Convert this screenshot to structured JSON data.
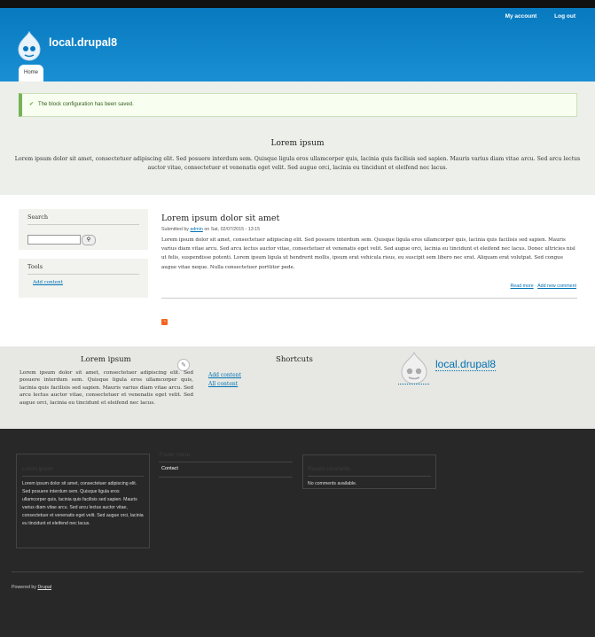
{
  "header": {
    "secondary_menu": [
      "My account",
      "Log out"
    ],
    "site_name": "local.drupal8",
    "tabs": [
      "Home"
    ],
    "logo_icon": "drupal-drop-icon",
    "colors": {
      "header": "#0779bf",
      "status_border": "#77b259",
      "link": "#0071b3"
    }
  },
  "status_message": "The block configuration has been saved.",
  "featured": {
    "title": "Lorem ipsum",
    "body": "Lorem ipsum dolor sit amet, consectetuer adipiscing elit. Sed posuere interdum sem. Quisque ligula eros ullamcorper quis, lacinia quis facilisis sed sapien. Mauris varius diam vitae arcu. Sed arcu lectus auctor vitae, consectetuer et venenatis eget velit. Sed augue orci, lacinia eu tincidunt et eleifend nec lacus."
  },
  "sidebar": {
    "search_title": "Search",
    "search_placeholder": "",
    "tools_title": "Tools",
    "tools_link": "Add content"
  },
  "article": {
    "title": "Lorem ipsum dolor sit amet",
    "submitted_prefix": "Submitted by",
    "author": "admin",
    "submitted_suffix": "on Sat, 02/07/2015 - 13:15",
    "body": "Lorem ipsum dolor sit amet, consectetuer adipiscing elit. Sed posuere interdum sem. Quisque ligula eros ullamcorper quis, lacinia quis facilisis sed sapien. Mauris varius diam vitae arcu. Sed arcu lectus auctor vitae, consectetuer et venenatis eget velit. Sed augue orci, lacinia eu tincidunt et eleifend nec lacus. Donec ultricies nisl ut felis, suspendisse potenti. Lorem ipsum ligula ut hendrerit mollis, ipsum erat vehicula risus, eu suscipit sem libero nec erat. Aliquam erat volutpat. Sed congue augue vitae neque. Nulla consectetuer porttitor pede.",
    "read_more": "Read more",
    "add_comment": "Add new comment"
  },
  "triptych": {
    "first_title": "Lorem ipsum",
    "first_body": "Lorem ipsum dolor sit amet, consectetuer adipiscing elit. Sed posuere interdum sem. Quisque ligula eros ullamcorper quis, lacinia quis facilisis sed sapien. Mauris varius diam vitae arcu. Sed arcu lectus auctor vitae, consectetuer et venenatis eget velit. Sed augue orci, lacinia eu tincidunt et eleifend nec lacus.",
    "shortcuts_title": "Shortcuts",
    "shortcut_links": [
      "Add content",
      "All content"
    ],
    "site_name": "local.drupal8"
  },
  "footer": {
    "block1_title": "Lorem ipsum",
    "block1_body": "Lorem ipsum dolor sit amet, consectetuer adipiscing elit. Sed posuere interdum sem. Quisque ligula eros ullamcorper quis, lacinia quis facilisis sed sapien. Mauris varius diam vitae arcu. Sed arcu lectus auctor vitae, consectetuer et venenatis eget velit. Sed augue orci, lacinia eu tincidunt et eleifend nec lacus.",
    "menu_title": "Footer menu",
    "menu_item": "Contact",
    "comments_title": "Recent comments",
    "comments_body": "No comments available.",
    "powered_prefix": "Powered by",
    "powered_link": "Drupal"
  }
}
